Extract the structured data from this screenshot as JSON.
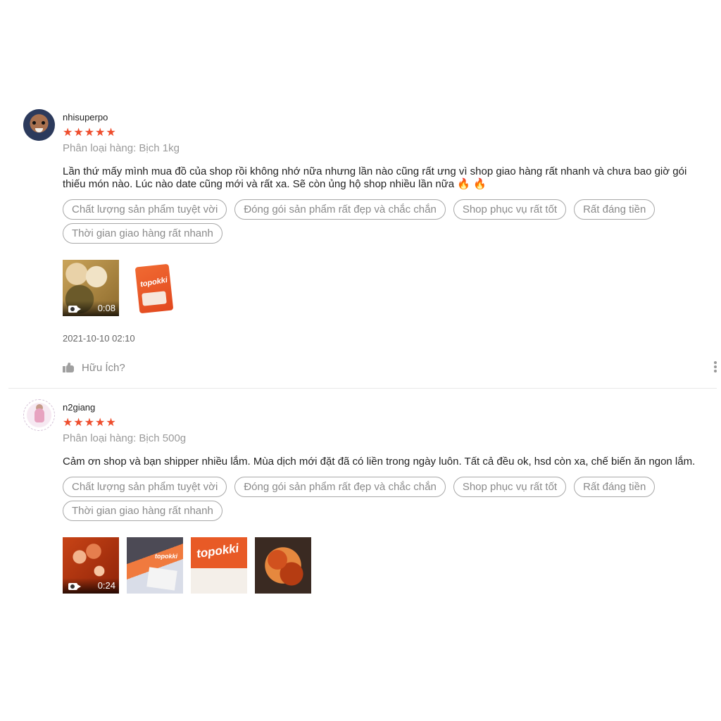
{
  "colors": {
    "star": "#ee4d2d",
    "muted": "#9a9a9a",
    "tag_border": "#a8a8a8"
  },
  "reviews": [
    {
      "username": "nhisuperpo",
      "rating": 5,
      "stars": "★★★★★",
      "variation": "Phân loại hàng: Bịch 1kg",
      "comment": "Lần thứ mấy mình mua đồ của shop rồi không nhớ nữa nhưng lần nào cũng rất ưng vì shop giao hàng rất nhanh và chưa bao giờ gói thiếu món nào. Lúc nào date cũng mới và rất xa. Sẽ còn ủng hộ shop nhiều lần nữa 🔥 🔥",
      "tags": [
        "Chất lượng sản phẩm tuyệt vời",
        "Đóng gói sản phẩm rất đẹp và chắc chắn",
        "Shop phục vụ rất tốt",
        "Rất đáng tiền",
        "Thời gian giao hàng rất nhanh"
      ],
      "media": [
        {
          "type": "video",
          "duration": "0:08",
          "icon": "video-camera-icon"
        },
        {
          "type": "image",
          "label": "topokki"
        }
      ],
      "timestamp": "2021-10-10 02:10",
      "helpful_label": "Hữu Ích?"
    },
    {
      "username": "n2giang",
      "rating": 5,
      "stars": "★★★★★",
      "variation": "Phân loại hàng: Bịch 500g",
      "comment": "Cảm ơn shop và bạn shipper nhiều lắm. Mùa dịch mới đặt đã có liền trong ngày luôn. Tất cả đều ok, hsd còn xa, chế biến ăn ngon lắm.",
      "tags": [
        "Chất lượng sản phẩm tuyệt vời",
        "Đóng gói sản phẩm rất đẹp và chắc chắn",
        "Shop phục vụ rất tốt",
        "Rất đáng tiền",
        "Thời gian giao hàng rất nhanh"
      ],
      "media": [
        {
          "type": "video",
          "duration": "0:24",
          "icon": "video-camera-icon"
        },
        {
          "type": "image",
          "label": "topokki"
        },
        {
          "type": "image",
          "label": "topokki"
        },
        {
          "type": "image"
        }
      ]
    }
  ]
}
